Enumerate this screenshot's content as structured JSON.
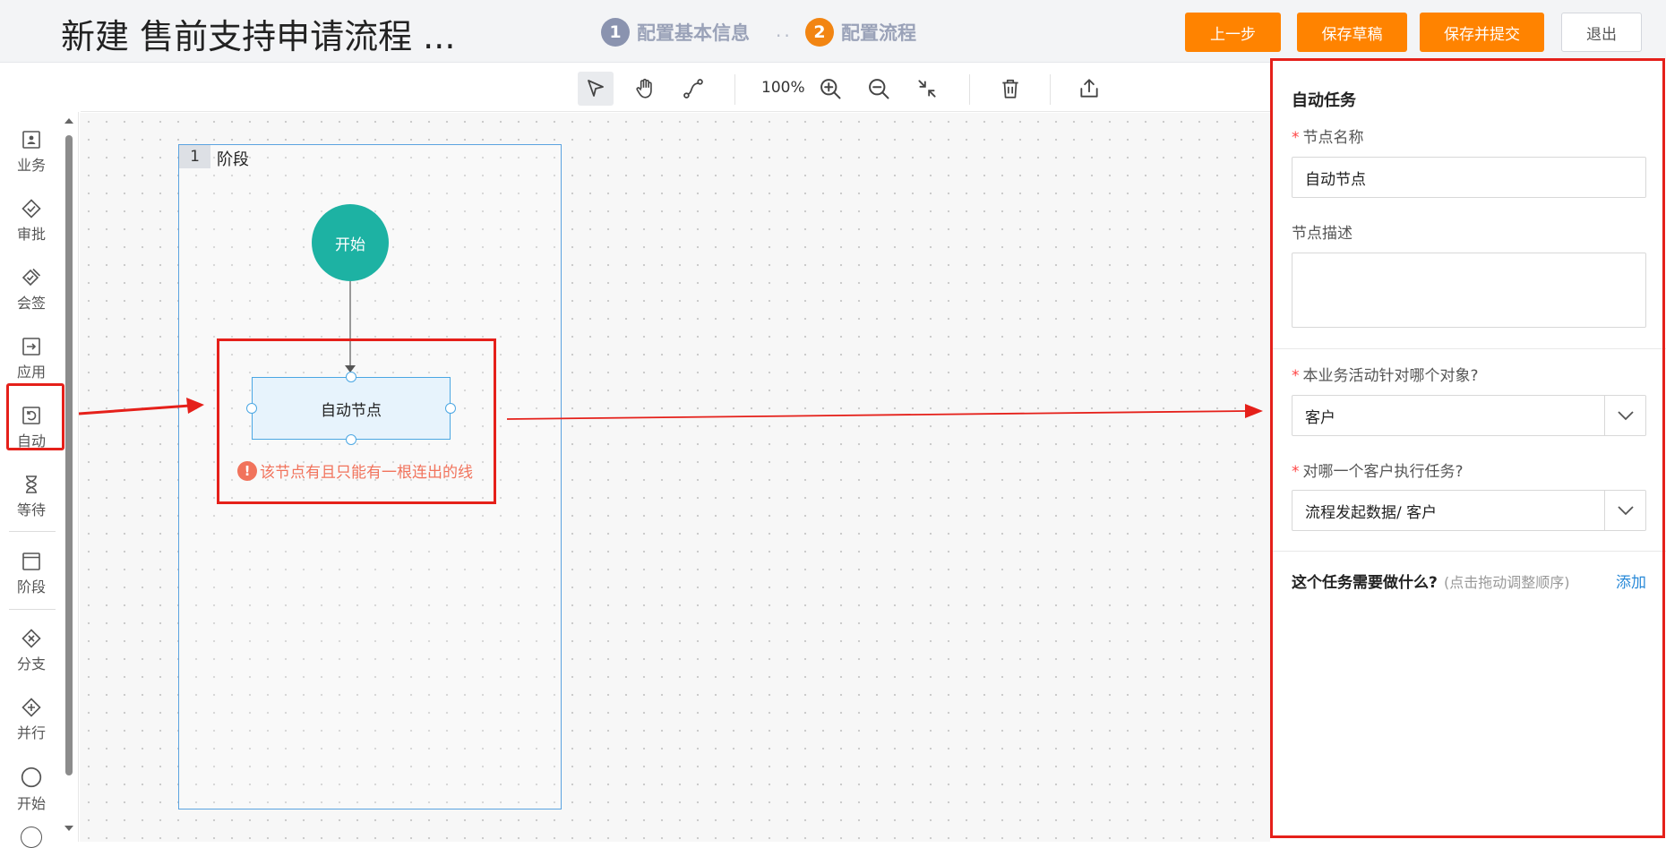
{
  "header": {
    "title": "新建 售前支持申请流程 ...",
    "steps": [
      {
        "num": "1",
        "label": "配置基本信息"
      },
      {
        "num": "2",
        "label": "配置流程"
      }
    ],
    "steps_separator": "..",
    "buttons": {
      "prev": "上一步",
      "save_draft": "保存草稿",
      "save_submit": "保存并提交",
      "exit": "退出"
    },
    "colors": {
      "primary_button": "#ff8300",
      "step_active": "#f28512",
      "step_inactive": "#8a93af"
    }
  },
  "toolbar": {
    "zoom_level": "100%",
    "tools": [
      "select-icon",
      "hand-icon",
      "connect-icon",
      "zoom-in-icon",
      "zoom-out-icon",
      "fit-icon",
      "delete-icon",
      "export-icon"
    ]
  },
  "palette": {
    "items": [
      {
        "label": "业务",
        "icon": "business-icon"
      },
      {
        "label": "审批",
        "icon": "approval-icon"
      },
      {
        "label": "会签",
        "icon": "countersign-icon"
      },
      {
        "label": "应用",
        "icon": "application-icon"
      },
      {
        "label": "自动",
        "icon": "auto-icon"
      },
      {
        "label": "等待",
        "icon": "hourglass-icon"
      },
      {
        "label": "阶段",
        "icon": "stage-icon"
      },
      {
        "label": "分支",
        "icon": "branch-icon"
      },
      {
        "label": "并行",
        "icon": "parallel-icon"
      },
      {
        "label": "开始",
        "icon": "start-icon"
      }
    ]
  },
  "canvas": {
    "stage": {
      "number": "1",
      "label": "阶段"
    },
    "start_node": "开始",
    "auto_node": "自动节点",
    "error_icon": "!",
    "error_message": "该节点有且只能有一根连出的线"
  },
  "panel": {
    "title": "自动任务",
    "node_name_label": "节点名称",
    "node_name_value": "自动节点",
    "node_desc_label": "节点描述",
    "node_desc_value": "",
    "object_label": "本业务活动针对哪个对象?",
    "object_value": "客户",
    "target_label": "对哪一个客户执行任务?",
    "target_value": "流程发起数据/ 客户",
    "task_title": "这个任务需要做什么?",
    "task_hint": "(点击拖动调整顺序)",
    "add_link": "添加"
  }
}
